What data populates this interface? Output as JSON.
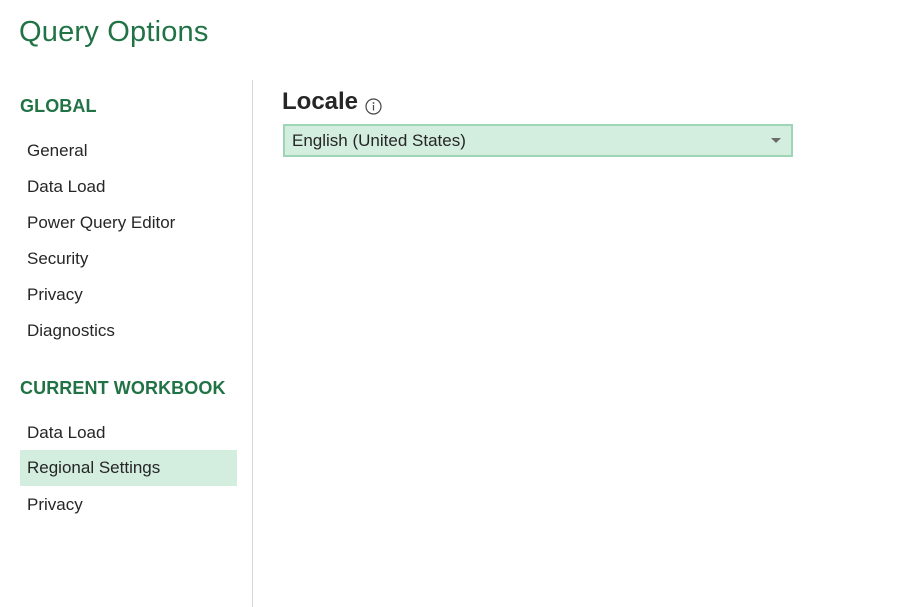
{
  "window": {
    "title": "Query Options"
  },
  "sidebar": {
    "global_header": "GLOBAL",
    "global_items": [
      {
        "label": "General"
      },
      {
        "label": "Data Load"
      },
      {
        "label": "Power Query Editor"
      },
      {
        "label": "Security"
      },
      {
        "label": "Privacy"
      },
      {
        "label": "Diagnostics"
      }
    ],
    "workbook_header": "CURRENT WORKBOOK",
    "workbook_items": [
      {
        "label": "Data Load"
      },
      {
        "label": "Regional Settings",
        "selected": true
      },
      {
        "label": "Privacy"
      }
    ]
  },
  "main": {
    "locale_heading": "Locale",
    "locale_info_icon": "info-circle-icon",
    "locale_select": {
      "value": "English (United States)"
    }
  },
  "colors": {
    "accent": "#217346",
    "selection_bg": "#d3eedf",
    "select_border": "#9fd5b7"
  }
}
